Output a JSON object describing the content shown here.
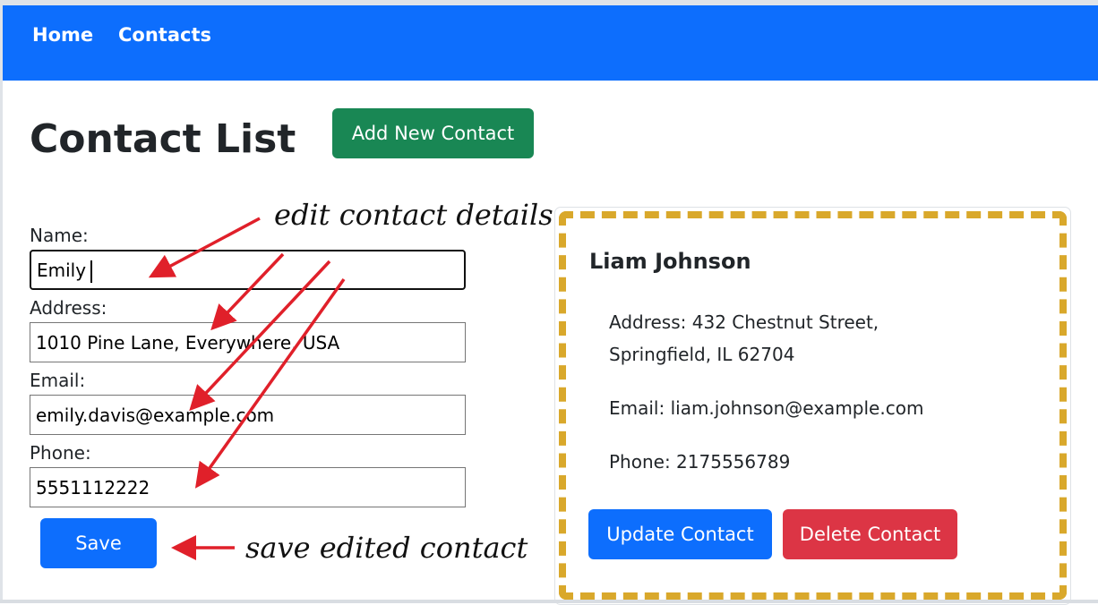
{
  "nav": {
    "items": [
      {
        "label": "Home"
      },
      {
        "label": "Contacts"
      }
    ]
  },
  "page": {
    "title": "Contact List",
    "add_button_label": "Add New Contact"
  },
  "form": {
    "name_label": "Name:",
    "name_value": "Emily",
    "address_label": "Address:",
    "address_value": "1010 Pine Lane, Everywhere, USA",
    "email_label": "Email:",
    "email_value": "emily.davis@example.com",
    "phone_label": "Phone:",
    "phone_value": "5551112222",
    "save_label": "Save"
  },
  "card": {
    "name": "Liam Johnson",
    "address_line1": "Address: 432 Chestnut Street,",
    "address_line2": "Springfield, IL 62704",
    "email": "Email: liam.johnson@example.com",
    "phone": "Phone: 2175556789",
    "update_label": "Update Contact",
    "delete_label": "Delete Contact"
  },
  "annotations": {
    "edit_note": "edit contact details",
    "save_note": "save edited contact"
  },
  "colors": {
    "navbar": "#0d6efd",
    "primary": "#0d6efd",
    "success": "#198754",
    "danger": "#dc3545",
    "highlight_border": "#d9a82b",
    "annotation_arrow": "#e0202a"
  }
}
